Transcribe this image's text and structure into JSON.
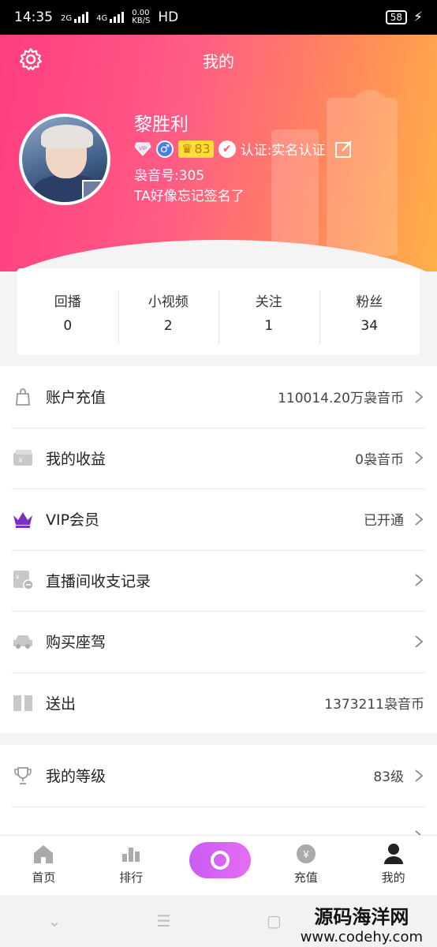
{
  "status_bar": {
    "time": "14:35",
    "net_1": "2G",
    "net_2": "4G",
    "speed": "0.00",
    "speed_unit": "KB/S",
    "hd": "HD",
    "battery": "58"
  },
  "header": {
    "title": "我的",
    "user_name": "黎胜利",
    "level_badge": "83",
    "verify_text": "认证:实名认证",
    "uid": "袅音号:305",
    "signature": "TA好像忘记签名了",
    "gender_symbol": "♂",
    "vip_label": "VIP"
  },
  "stats": [
    {
      "label": "回播",
      "value": "0"
    },
    {
      "label": "小视频",
      "value": "2"
    },
    {
      "label": "关注",
      "value": "1"
    },
    {
      "label": "粉丝",
      "value": "34"
    }
  ],
  "menu1": [
    {
      "label": "账户充值",
      "value": "110014.20万袅音币",
      "icon": "wallet-bag-icon"
    },
    {
      "label": "我的收益",
      "value": "0袅音币",
      "icon": "cash-card-icon"
    },
    {
      "label": "VIP会员",
      "value": "已开通",
      "icon": "crown-icon"
    },
    {
      "label": "直播间收支记录",
      "value": "",
      "icon": "ledger-icon"
    },
    {
      "label": "购买座驾",
      "value": "",
      "icon": "car-icon"
    },
    {
      "label": "送出",
      "value": "1373211袅音币",
      "icon": "gift-icon"
    }
  ],
  "menu2": [
    {
      "label": "我的等级",
      "value": "83级",
      "icon": "trophy-icon"
    }
  ],
  "bottom_nav": [
    {
      "label": "首页",
      "icon": "home-icon"
    },
    {
      "label": "排行",
      "icon": "ranking-icon"
    },
    {
      "label": "",
      "icon": "live-icon"
    },
    {
      "label": "充值",
      "icon": "yen-coin-icon"
    },
    {
      "label": "我的",
      "icon": "user-icon"
    }
  ],
  "watermark": {
    "line1": "源码海洋网",
    "line2": "www.codehy.com"
  },
  "colors": {
    "header_start": "#ff3d7f",
    "header_end": "#ffb048",
    "vip_crown": "#7a2fc9",
    "live_button": "#d765f4"
  }
}
